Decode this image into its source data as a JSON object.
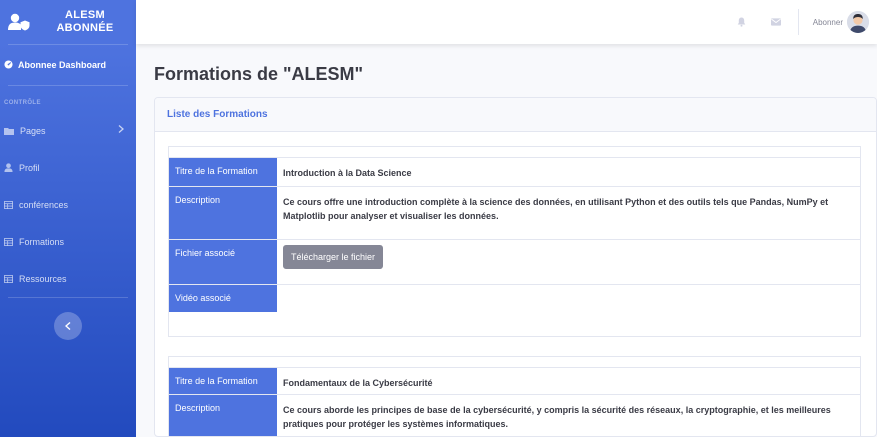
{
  "sidebar": {
    "brand_line1": "ALESM",
    "brand_line2": "ABONNÉE",
    "dashboard_label": "Abonnee Dashboard",
    "heading": "CONTRÔLE",
    "items": [
      {
        "label": "Pages",
        "icon": "folder-icon"
      },
      {
        "label": "Profil",
        "icon": "user-icon"
      },
      {
        "label": "conférences",
        "icon": "table-icon"
      },
      {
        "label": "Formations",
        "icon": "table-icon"
      },
      {
        "label": "Ressources",
        "icon": "table-icon"
      }
    ]
  },
  "topbar": {
    "user_name": "Abonner"
  },
  "page": {
    "title": "Formations de \"ALESM\"",
    "card_title": "Liste des Formations"
  },
  "formations": [
    {
      "title_label": "Titre de la Formation",
      "title": "Introduction à la Data Science",
      "description_label": "Description",
      "description": "Ce cours offre une introduction complète à la science des données, en utilisant Python et des outils tels que Pandas, NumPy et Matplotlib pour analyser et visualiser les données.",
      "file_label": "Fichier associé",
      "file_button": "Télécharger le fichier",
      "video_label": "Vidéo associé"
    },
    {
      "title_label": "Titre de la Formation",
      "title": "Fondamentaux de la Cybersécurité",
      "description_label": "Description",
      "description": "Ce cours aborde les principes de base de la cybersécurité, y compris la sécurité des réseaux, la cryptographie, et les meilleures pratiques pour protéger les systèmes informatiques."
    }
  ],
  "colors": {
    "primary": "#4e73df",
    "secondary_button": "#858796"
  }
}
